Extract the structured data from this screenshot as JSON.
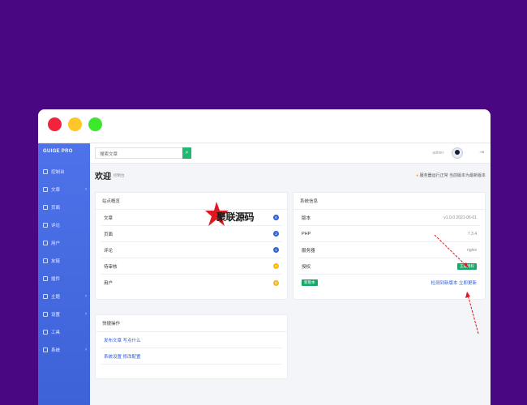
{
  "window": {
    "controls": [
      "close",
      "minimize",
      "maximize"
    ]
  },
  "sidebar": {
    "brand": "GUIGE PRO",
    "items": [
      {
        "label": "控制台",
        "arrow": ""
      },
      {
        "label": "文章",
        "arrow": "›"
      },
      {
        "label": "页面",
        "arrow": ""
      },
      {
        "label": "评论",
        "arrow": ""
      },
      {
        "label": "用户",
        "arrow": ""
      },
      {
        "label": "友链",
        "arrow": ""
      },
      {
        "label": "插件",
        "arrow": ""
      },
      {
        "label": "主题",
        "arrow": "›"
      },
      {
        "label": "设置",
        "arrow": "›"
      },
      {
        "label": "工具",
        "arrow": ""
      },
      {
        "label": "系统",
        "arrow": "›"
      }
    ]
  },
  "topbar": {
    "search_placeholder": "搜索文章",
    "search_icon": "search-icon",
    "user_name": "admin",
    "logout_icon": "logout-icon"
  },
  "pagehead": {
    "welcome": "欢迎",
    "sub": "控制台",
    "notice": "服务器运行正常 当前版本为最新版本"
  },
  "overview": {
    "title": "站点概览",
    "rows": [
      {
        "label": "文章",
        "count": "6",
        "color": "blue"
      },
      {
        "label": "页面",
        "count": "3",
        "color": "blue"
      },
      {
        "label": "评论",
        "count": "1",
        "color": "blue"
      },
      {
        "label": "待审核",
        "count": "0",
        "color": "yellow"
      },
      {
        "label": "用户",
        "count": "0",
        "color": "yellow"
      }
    ]
  },
  "system": {
    "title": "系统信息",
    "rows": [
      {
        "label": "版本",
        "value": "v1.0.0 2021-06-01"
      },
      {
        "label": "PHP",
        "value": "7.3.4"
      },
      {
        "label": "服务器",
        "value": "nginx"
      },
      {
        "label": "授权",
        "value": "正版授权"
      },
      {
        "label": "更新",
        "value": "检测到新版本 立即更新"
      }
    ],
    "update_tag": "新版本"
  },
  "shortcuts": {
    "title": "快捷操作",
    "links": [
      "发布文章 写点什么",
      "系统设置 修改配置"
    ]
  },
  "watermark": {
    "text": "聚联源码"
  },
  "colors": {
    "background": "#4a0782",
    "sidebar": "#4e72e9",
    "accent_green": "#1aa866",
    "badge_blue": "#2f63d6",
    "badge_yellow": "#f6b91d",
    "arrow_red": "#e0171f"
  }
}
